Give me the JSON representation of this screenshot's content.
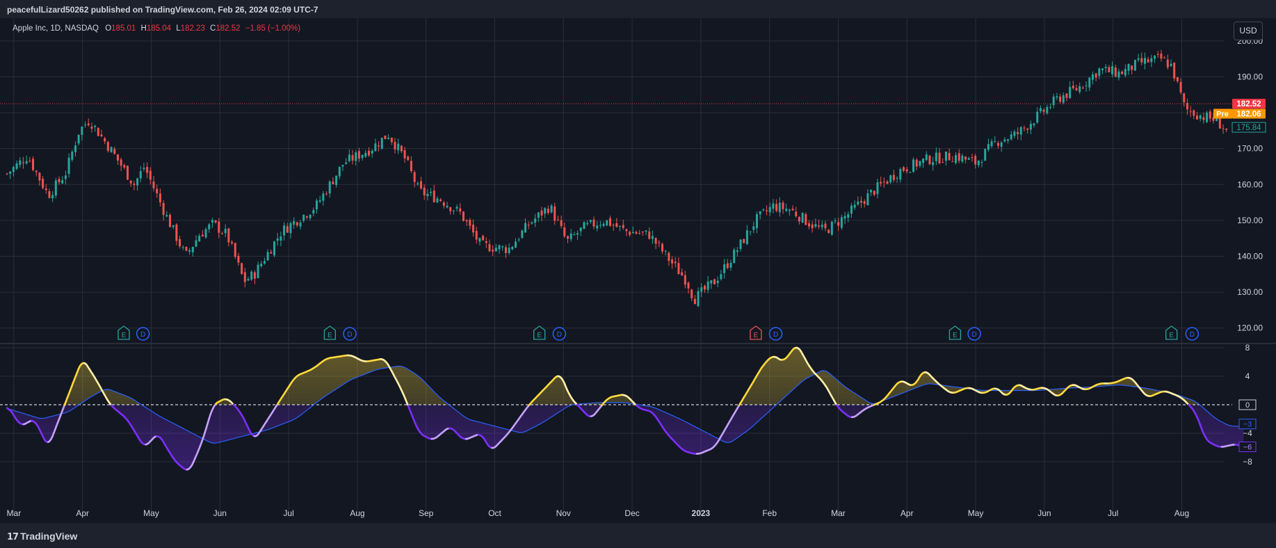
{
  "header": {
    "published": "peacefulLizard50262 published on TradingView.com, Feb 26, 2024 02:09 UTC-7"
  },
  "legend": {
    "symbol": "Apple Inc, 1D, NASDAQ",
    "o_label": "O",
    "o_val": "185.01",
    "h_label": "H",
    "h_val": "185.04",
    "l_label": "L",
    "l_val": "182.23",
    "c_label": "C",
    "c_val": "182.52",
    "change": "−1.85 (−1.00%)"
  },
  "currency_button": "USD",
  "footer": {
    "brand": "TradingView"
  },
  "colors": {
    "background": "#131722",
    "grid": "#2a2e39",
    "up": "#26a69a",
    "down": "#ef5350",
    "osc_positive": "#ffd93b",
    "osc_negative": "#7b2ff7",
    "signal": "#2962ff",
    "price_line": "#f23645",
    "pre_market": "#ff9800"
  },
  "chart_data": [
    {
      "type": "candlestick",
      "instrument": "Apple Inc",
      "interval": "1D",
      "exchange": "NASDAQ",
      "ylim": [
        118,
        202
      ],
      "y_ticks": [
        "120.00",
        "130.00",
        "140.00",
        "150.00",
        "160.00",
        "170.00",
        "180.00",
        "190.00",
        "200.00"
      ],
      "x_ticks": [
        "Mar",
        "Apr",
        "May",
        "Jun",
        "Jul",
        "Aug",
        "Sep",
        "Oct",
        "Nov",
        "Dec",
        "2023",
        "Feb",
        "Mar",
        "Apr",
        "May",
        "Jun",
        "Jul",
        "Aug"
      ],
      "closing_path": [
        {
          "m": 0.0,
          "p": 163
        },
        {
          "m": 0.3,
          "p": 168
        },
        {
          "m": 0.6,
          "p": 157
        },
        {
          "m": 0.85,
          "p": 163
        },
        {
          "m": 1.05,
          "p": 175
        },
        {
          "m": 1.2,
          "p": 178
        },
        {
          "m": 1.5,
          "p": 170
        },
        {
          "m": 1.85,
          "p": 160
        },
        {
          "m": 2.0,
          "p": 165
        },
        {
          "m": 2.3,
          "p": 152
        },
        {
          "m": 2.6,
          "p": 140
        },
        {
          "m": 2.8,
          "p": 146
        },
        {
          "m": 3.0,
          "p": 149
        },
        {
          "m": 3.2,
          "p": 146
        },
        {
          "m": 3.45,
          "p": 133
        },
        {
          "m": 3.6,
          "p": 135
        },
        {
          "m": 4.0,
          "p": 147
        },
        {
          "m": 4.5,
          "p": 154
        },
        {
          "m": 4.9,
          "p": 166
        },
        {
          "m": 5.3,
          "p": 170
        },
        {
          "m": 5.55,
          "p": 174
        },
        {
          "m": 5.8,
          "p": 167
        },
        {
          "m": 6.0,
          "p": 158
        },
        {
          "m": 6.3,
          "p": 156
        },
        {
          "m": 6.6,
          "p": 152
        },
        {
          "m": 6.9,
          "p": 143
        },
        {
          "m": 7.3,
          "p": 142
        },
        {
          "m": 7.6,
          "p": 149
        },
        {
          "m": 7.9,
          "p": 154
        },
        {
          "m": 8.15,
          "p": 144
        },
        {
          "m": 8.4,
          "p": 148
        },
        {
          "m": 8.7,
          "p": 150
        },
        {
          "m": 9.0,
          "p": 147
        },
        {
          "m": 9.35,
          "p": 146
        },
        {
          "m": 9.6,
          "p": 140
        },
        {
          "m": 9.9,
          "p": 133
        },
        {
          "m": 10.0,
          "p": 128
        },
        {
          "m": 10.3,
          "p": 133
        },
        {
          "m": 10.6,
          "p": 141
        },
        {
          "m": 10.9,
          "p": 150
        },
        {
          "m": 11.15,
          "p": 154
        },
        {
          "m": 11.4,
          "p": 153
        },
        {
          "m": 11.7,
          "p": 149
        },
        {
          "m": 11.9,
          "p": 147
        },
        {
          "m": 12.2,
          "p": 151
        },
        {
          "m": 12.6,
          "p": 158
        },
        {
          "m": 13.0,
          "p": 164
        },
        {
          "m": 13.4,
          "p": 167
        },
        {
          "m": 13.8,
          "p": 168
        },
        {
          "m": 14.1,
          "p": 166
        },
        {
          "m": 14.4,
          "p": 172
        },
        {
          "m": 14.7,
          "p": 174
        },
        {
          "m": 15.0,
          "p": 179
        },
        {
          "m": 15.3,
          "p": 184
        },
        {
          "m": 15.6,
          "p": 187
        },
        {
          "m": 15.9,
          "p": 192
        },
        {
          "m": 16.2,
          "p": 191
        },
        {
          "m": 16.5,
          "p": 194
        },
        {
          "m": 16.8,
          "p": 195
        },
        {
          "m": 16.95,
          "p": 193
        },
        {
          "m": 17.15,
          "p": 181
        },
        {
          "m": 17.4,
          "p": 179
        },
        {
          "m": 17.6,
          "p": 178
        },
        {
          "m": 17.75,
          "p": 175
        }
      ],
      "price_labels": {
        "last": "182.52",
        "pre_tag": "Pre",
        "pre_value": "182.06",
        "marker": "175.84"
      },
      "events": [
        {
          "m": 1.7,
          "kind": "E",
          "result": "beat"
        },
        {
          "m": 1.98,
          "kind": "D"
        },
        {
          "m": 4.7,
          "kind": "E",
          "result": "beat"
        },
        {
          "m": 4.99,
          "kind": "D"
        },
        {
          "m": 7.75,
          "kind": "E",
          "result": "beat"
        },
        {
          "m": 8.04,
          "kind": "D"
        },
        {
          "m": 10.9,
          "kind": "E",
          "result": "miss"
        },
        {
          "m": 11.19,
          "kind": "D"
        },
        {
          "m": 13.8,
          "kind": "E",
          "result": "beat"
        },
        {
          "m": 14.08,
          "kind": "D"
        },
        {
          "m": 16.95,
          "kind": "E",
          "result": "beat"
        },
        {
          "m": 17.25,
          "kind": "D"
        }
      ]
    },
    {
      "type": "line",
      "name": "",
      "ylim": [
        -12,
        11
      ],
      "y_ticks": [
        "8",
        "4",
        "-4",
        "-8"
      ],
      "zero_tag": "0",
      "signal_tag": "−3",
      "value_tag": "−6",
      "oscillator": [
        {
          "m": 0.0,
          "v": 0
        },
        {
          "m": 0.2,
          "v": -3
        },
        {
          "m": 0.4,
          "v": -2
        },
        {
          "m": 0.6,
          "v": -6
        },
        {
          "m": 0.8,
          "v": -1
        },
        {
          "m": 1.0,
          "v": 4
        },
        {
          "m": 1.1,
          "v": 6.5
        },
        {
          "m": 1.3,
          "v": 3.5
        },
        {
          "m": 1.5,
          "v": 0
        },
        {
          "m": 1.75,
          "v": -2
        },
        {
          "m": 2.0,
          "v": -6
        },
        {
          "m": 2.2,
          "v": -4
        },
        {
          "m": 2.45,
          "v": -8
        },
        {
          "m": 2.65,
          "v": -9.5
        },
        {
          "m": 2.85,
          "v": -5
        },
        {
          "m": 3.0,
          "v": 0
        },
        {
          "m": 3.2,
          "v": 1
        },
        {
          "m": 3.4,
          "v": -1
        },
        {
          "m": 3.6,
          "v": -5
        },
        {
          "m": 3.8,
          "v": -2
        },
        {
          "m": 4.0,
          "v": 1
        },
        {
          "m": 4.2,
          "v": 4
        },
        {
          "m": 4.45,
          "v": 5
        },
        {
          "m": 4.65,
          "v": 6.5
        },
        {
          "m": 5.0,
          "v": 7
        },
        {
          "m": 5.2,
          "v": 6
        },
        {
          "m": 5.5,
          "v": 6.5
        },
        {
          "m": 5.75,
          "v": 2
        },
        {
          "m": 6.0,
          "v": -4
        },
        {
          "m": 6.2,
          "v": -5
        },
        {
          "m": 6.45,
          "v": -3
        },
        {
          "m": 6.65,
          "v": -5
        },
        {
          "m": 6.9,
          "v": -4
        },
        {
          "m": 7.05,
          "v": -6.5
        },
        {
          "m": 7.3,
          "v": -4
        },
        {
          "m": 7.6,
          "v": 0
        },
        {
          "m": 7.9,
          "v": 3
        },
        {
          "m": 8.05,
          "v": 4.5
        },
        {
          "m": 8.2,
          "v": 1
        },
        {
          "m": 8.5,
          "v": -2
        },
        {
          "m": 8.75,
          "v": 1
        },
        {
          "m": 9.0,
          "v": 1.5
        },
        {
          "m": 9.2,
          "v": -0.5
        },
        {
          "m": 9.4,
          "v": -1
        },
        {
          "m": 9.6,
          "v": -4
        },
        {
          "m": 9.85,
          "v": -6.5
        },
        {
          "m": 10.05,
          "v": -7
        },
        {
          "m": 10.3,
          "v": -6
        },
        {
          "m": 10.6,
          "v": -1
        },
        {
          "m": 10.85,
          "v": 3
        },
        {
          "m": 11.0,
          "v": 5.5
        },
        {
          "m": 11.15,
          "v": 7
        },
        {
          "m": 11.3,
          "v": 6
        },
        {
          "m": 11.5,
          "v": 8.5
        },
        {
          "m": 11.7,
          "v": 5
        },
        {
          "m": 11.9,
          "v": 3
        },
        {
          "m": 12.1,
          "v": -0.5
        },
        {
          "m": 12.3,
          "v": -2
        },
        {
          "m": 12.5,
          "v": -0.5
        },
        {
          "m": 12.75,
          "v": 0.5
        },
        {
          "m": 13.0,
          "v": 3.5
        },
        {
          "m": 13.2,
          "v": 2.5
        },
        {
          "m": 13.35,
          "v": 5
        },
        {
          "m": 13.55,
          "v": 3
        },
        {
          "m": 13.75,
          "v": 1.5
        },
        {
          "m": 14.0,
          "v": 2.5
        },
        {
          "m": 14.2,
          "v": 1.5
        },
        {
          "m": 14.4,
          "v": 2.5
        },
        {
          "m": 14.55,
          "v": 1
        },
        {
          "m": 14.7,
          "v": 3
        },
        {
          "m": 14.9,
          "v": 2
        },
        {
          "m": 15.1,
          "v": 2.5
        },
        {
          "m": 15.3,
          "v": 1
        },
        {
          "m": 15.5,
          "v": 3
        },
        {
          "m": 15.7,
          "v": 2
        },
        {
          "m": 15.9,
          "v": 3
        },
        {
          "m": 16.1,
          "v": 3
        },
        {
          "m": 16.35,
          "v": 4
        },
        {
          "m": 16.6,
          "v": 1
        },
        {
          "m": 16.85,
          "v": 2
        },
        {
          "m": 17.1,
          "v": 1
        },
        {
          "m": 17.3,
          "v": -1
        },
        {
          "m": 17.45,
          "v": -5
        },
        {
          "m": 17.65,
          "v": -6
        },
        {
          "m": 17.9,
          "v": -5.5
        },
        {
          "m": 18.0,
          "v": -6
        }
      ],
      "signal": [
        {
          "m": 0.0,
          "v": -0.5
        },
        {
          "m": 0.5,
          "v": -2
        },
        {
          "m": 0.9,
          "v": -1
        },
        {
          "m": 1.2,
          "v": 1
        },
        {
          "m": 1.45,
          "v": 2.3
        },
        {
          "m": 1.8,
          "v": 1
        },
        {
          "m": 2.2,
          "v": -1.5
        },
        {
          "m": 2.6,
          "v": -3.5
        },
        {
          "m": 3.0,
          "v": -5.5
        },
        {
          "m": 3.4,
          "v": -4.5
        },
        {
          "m": 3.8,
          "v": -3.5
        },
        {
          "m": 4.2,
          "v": -2
        },
        {
          "m": 4.6,
          "v": 1
        },
        {
          "m": 5.0,
          "v": 3.5
        },
        {
          "m": 5.4,
          "v": 5
        },
        {
          "m": 5.75,
          "v": 5.5
        },
        {
          "m": 6.0,
          "v": 4
        },
        {
          "m": 6.3,
          "v": 1
        },
        {
          "m": 6.7,
          "v": -2
        },
        {
          "m": 7.1,
          "v": -3
        },
        {
          "m": 7.5,
          "v": -4
        },
        {
          "m": 7.8,
          "v": -2.5
        },
        {
          "m": 8.2,
          "v": 0
        },
        {
          "m": 8.6,
          "v": 0.3
        },
        {
          "m": 9.0,
          "v": 0.3
        },
        {
          "m": 9.4,
          "v": -0.3
        },
        {
          "m": 9.8,
          "v": -2
        },
        {
          "m": 10.2,
          "v": -4
        },
        {
          "m": 10.5,
          "v": -5.5
        },
        {
          "m": 10.8,
          "v": -3.5
        },
        {
          "m": 11.2,
          "v": 0
        },
        {
          "m": 11.6,
          "v": 3.5
        },
        {
          "m": 11.9,
          "v": 5
        },
        {
          "m": 12.2,
          "v": 2.5
        },
        {
          "m": 12.6,
          "v": 0
        },
        {
          "m": 13.0,
          "v": 1.5
        },
        {
          "m": 13.4,
          "v": 3
        },
        {
          "m": 13.8,
          "v": 2.5
        },
        {
          "m": 14.2,
          "v": 2
        },
        {
          "m": 14.6,
          "v": 2
        },
        {
          "m": 15.0,
          "v": 2
        },
        {
          "m": 15.4,
          "v": 2.3
        },
        {
          "m": 15.8,
          "v": 2.5
        },
        {
          "m": 16.2,
          "v": 2.8
        },
        {
          "m": 16.6,
          "v": 2.3
        },
        {
          "m": 17.0,
          "v": 1.5
        },
        {
          "m": 17.3,
          "v": 0.5
        },
        {
          "m": 17.6,
          "v": -2
        },
        {
          "m": 17.8,
          "v": -3
        },
        {
          "m": 18.0,
          "v": -3
        }
      ]
    }
  ]
}
